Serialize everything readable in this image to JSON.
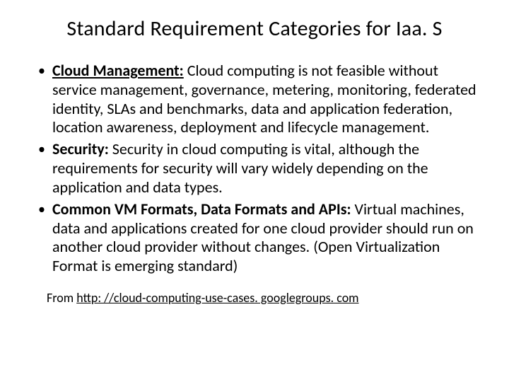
{
  "title": "Standard Requirement Categories for Iaa. S",
  "bullets": [
    {
      "lead": "Cloud Management:",
      "lead_underline": true,
      "body": " Cloud computing is not feasible without service management, governance, metering, monitoring, federated identity, SLAs and benchmarks, data and application federation, location awareness, deployment and lifecycle management."
    },
    {
      "lead": "Security:",
      "lead_underline": false,
      "body": " Security in cloud computing is vital, although the requirements for security will vary widely depending on the application and data types."
    },
    {
      "lead": "Common VM Formats, Data Formats and APIs:",
      "lead_underline": false,
      "body": " Virtual machines, data and applications created for one cloud provider should run on another cloud provider without changes. (Open Virtualization Format is emerging standard)"
    }
  ],
  "source_prefix": "From ",
  "source_url_text": "http: //cloud-computing-use-cases. googlegroups. com"
}
